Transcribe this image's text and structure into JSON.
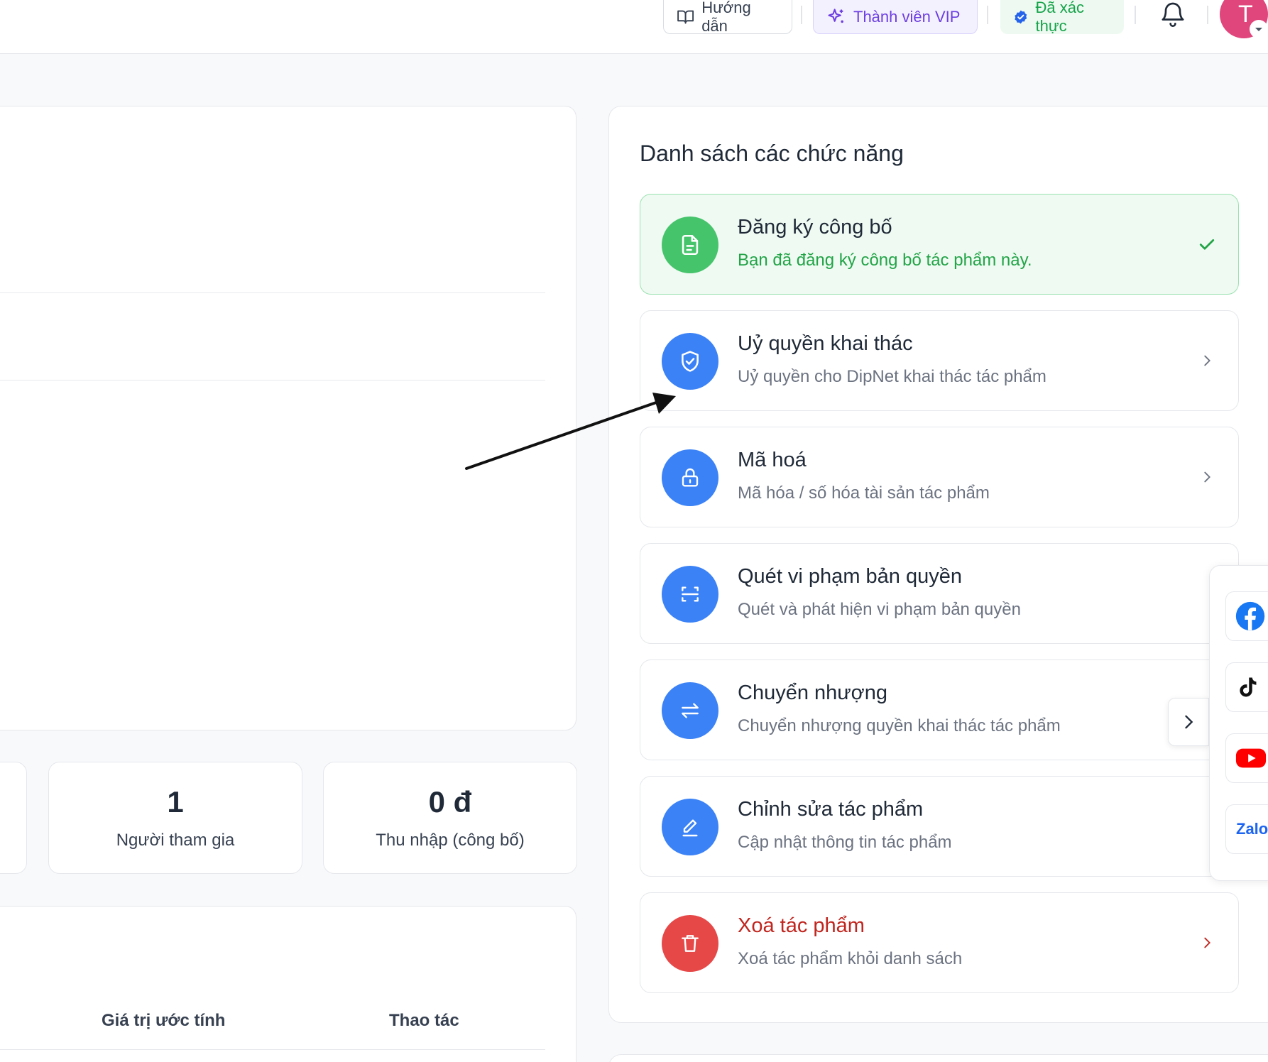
{
  "header": {
    "guide_label": "Hướng dẫn",
    "vip_label": "Thành viên VIP",
    "verified_label": "Đã xác thực",
    "avatar_initial": "T"
  },
  "stats": [
    {
      "value": "1",
      "label": "Người tham gia"
    },
    {
      "value": "0 đ",
      "label": "Thu nhập (công bố)"
    }
  ],
  "table": {
    "columns": [
      "Giá trị ước tính",
      "Thao tác"
    ]
  },
  "panel": {
    "title": "Danh sách các chức năng",
    "features": [
      {
        "title": "Đăng ký công bố",
        "subtitle": "Bạn đã đăng ký công bố tác phẩm này.",
        "icon": "document-icon",
        "state": "completed"
      },
      {
        "title": "Uỷ quyền khai thác",
        "subtitle": "Uỷ quyền cho DipNet khai thác tác phẩm",
        "icon": "shield-check-icon",
        "state": "default"
      },
      {
        "title": "Mã hoá",
        "subtitle": "Mã hóa / số hóa tài sản tác phẩm",
        "icon": "lock-icon",
        "state": "default"
      },
      {
        "title": "Quét vi phạm bản quyền",
        "subtitle": "Quét và phát hiện vi phạm bản quyền",
        "icon": "scan-icon",
        "state": "default"
      },
      {
        "title": "Chuyển nhượng",
        "subtitle": "Chuyển nhượng quyền khai thác tác phẩm",
        "icon": "transfer-icon",
        "state": "default"
      },
      {
        "title": "Chỉnh sửa tác phẩm",
        "subtitle": "Cập nhật thông tin tác phẩm",
        "icon": "edit-icon",
        "state": "default"
      },
      {
        "title": "Xoá tác phẩm",
        "subtitle": "Xoá tác phẩm khỏi danh sách",
        "icon": "trash-icon",
        "state": "danger"
      }
    ]
  },
  "social": {
    "items": [
      "facebook-icon",
      "tiktok-icon",
      "youtube-icon"
    ],
    "zalo_label": "Zalo"
  },
  "colors": {
    "primary": "#3b82f6",
    "success": "#46c46c",
    "danger": "#e64848",
    "vip": "#6d3fe0"
  }
}
